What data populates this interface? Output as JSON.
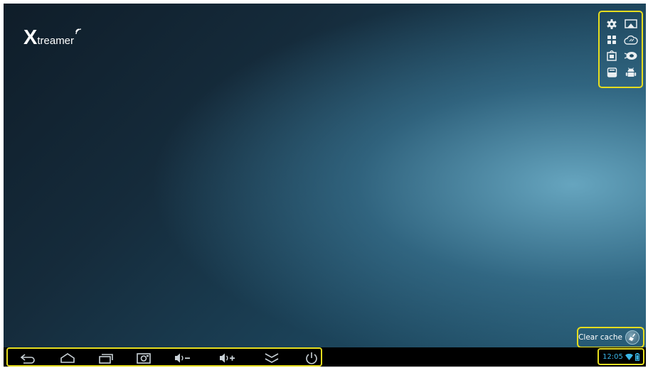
{
  "logo": {
    "x": "X",
    "rest": "treamer"
  },
  "quick_icons": [
    {
      "name": "settings-icon"
    },
    {
      "name": "screen-mirror-icon"
    },
    {
      "name": "apps-grid-icon"
    },
    {
      "name": "cloud-icon"
    },
    {
      "name": "media-icon"
    },
    {
      "name": "remote-icon"
    },
    {
      "name": "file-manager-icon"
    },
    {
      "name": "android-icon"
    }
  ],
  "clear_cache": {
    "label": "Clear cache",
    "icon": "broom-icon"
  },
  "navbar": {
    "buttons": [
      {
        "name": "back-icon"
      },
      {
        "name": "home-icon"
      },
      {
        "name": "recent-apps-icon"
      },
      {
        "name": "screenshot-icon"
      },
      {
        "name": "volume-down-icon"
      },
      {
        "name": "volume-up-icon"
      },
      {
        "name": "collapse-icon"
      },
      {
        "name": "power-icon"
      }
    ]
  },
  "status": {
    "time": "12:05",
    "icons": [
      "wifi-icon",
      "battery-icon"
    ]
  },
  "colors": {
    "highlight": "#e6dd1e",
    "status_blue": "#3ab7e8",
    "navbar": "#000000"
  }
}
